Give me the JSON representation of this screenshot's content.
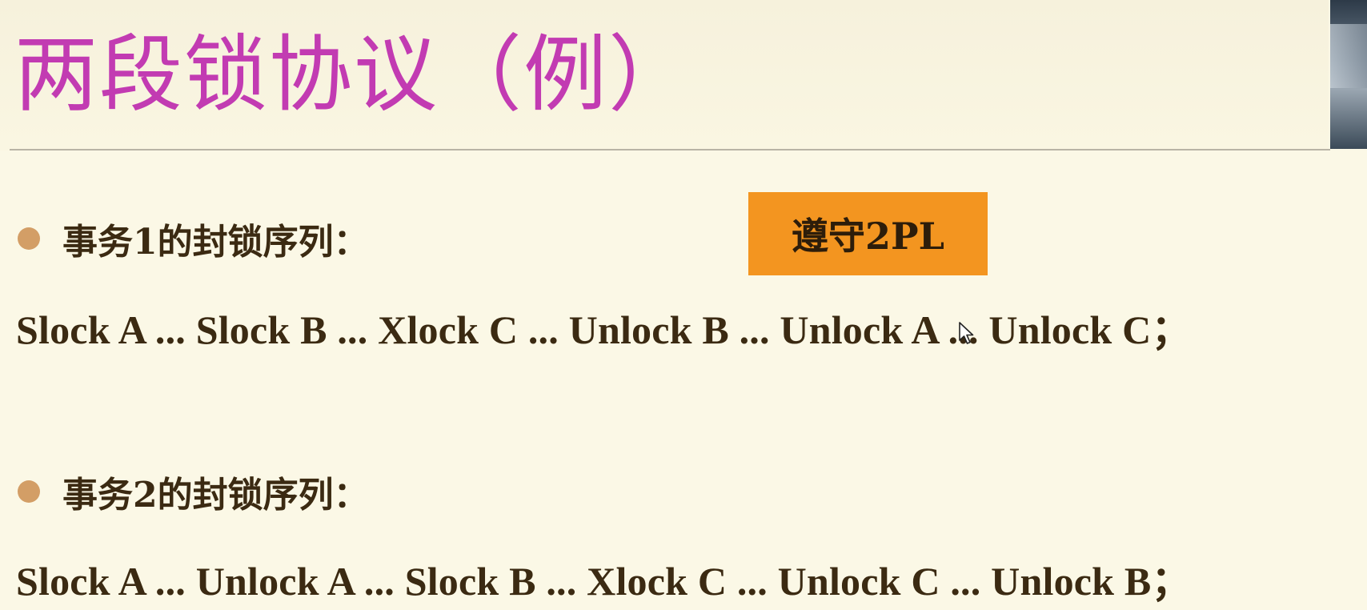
{
  "slide": {
    "title": "两段锁协议（例）"
  },
  "transactions": [
    {
      "heading": "事务1的封锁序列：",
      "sequence": "Slock A ... Slock B ... Xlock C ... Unlock B ... Unlock A ... Unlock C；"
    },
    {
      "heading": "事务2的封锁序列：",
      "sequence": "Slock A ... Unlock A ... Slock B ... Xlock C ... Unlock C ... Unlock B；"
    }
  ],
  "badge": {
    "label": "遵守2PL",
    "color": "#f39520"
  },
  "colors": {
    "title": "#c23bb2",
    "background": "#fbf8e6",
    "bullet": "#d39e66",
    "text": "#3b2a12"
  },
  "icons": {
    "bullet": "filled-circle",
    "cursor": "mouse-pointer-arrow"
  }
}
